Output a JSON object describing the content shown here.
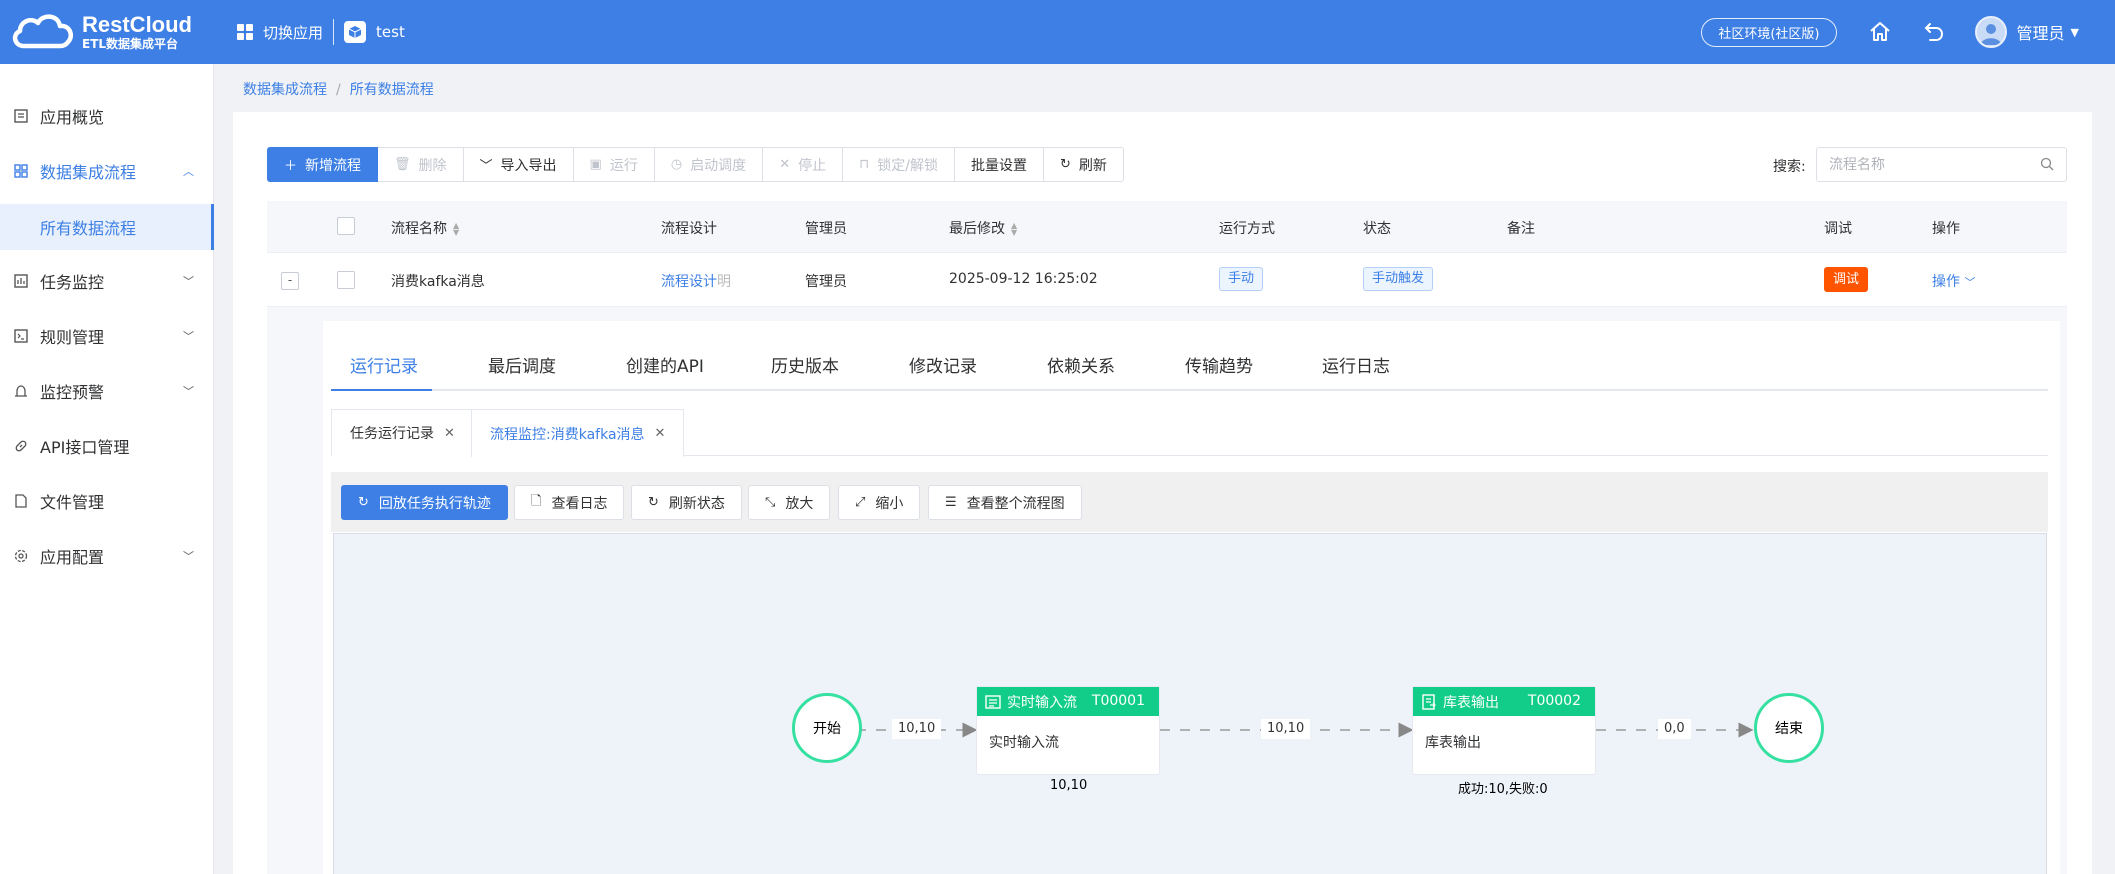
{
  "header": {
    "brand": "RestCloud",
    "brand_sub": "ETL数据集成平台",
    "switch_app": "切换应用",
    "app_name": "test",
    "env": "社区环境(社区版)",
    "user": "管理员"
  },
  "sidebar": {
    "items": [
      {
        "label": "应用概览",
        "icon": "overview-icon"
      },
      {
        "label": "数据集成流程",
        "icon": "grid-icon"
      },
      {
        "label": "所有数据流程"
      },
      {
        "label": "任务监控",
        "icon": "monitor-icon"
      },
      {
        "label": "规则管理",
        "icon": "terminal-icon"
      },
      {
        "label": "监控预警",
        "icon": "alarm-icon"
      },
      {
        "label": "API接口管理",
        "icon": "link-icon"
      },
      {
        "label": "文件管理",
        "icon": "file-icon"
      },
      {
        "label": "应用配置",
        "icon": "gear-icon"
      }
    ]
  },
  "breadcrumb": [
    "数据集成流程",
    "所有数据流程"
  ],
  "toolbar": {
    "new": "新增流程",
    "delete": "删除",
    "import_export": "导入导出",
    "run": "运行",
    "start_schedule": "启动调度",
    "stop": "停止",
    "lock": "锁定/解锁",
    "batch": "批量设置",
    "refresh": "刷新"
  },
  "search": {
    "label": "搜索:",
    "placeholder": "流程名称"
  },
  "table": {
    "columns": [
      "流程名称",
      "流程设计",
      "管理员",
      "最后修改",
      "运行方式",
      "状态",
      "备注",
      "调试",
      "操作"
    ],
    "row": {
      "expand": "-",
      "name": "消费kafka消息",
      "design": "流程设计",
      "design_suffix": "明",
      "admin": "管理员",
      "modified": "2025-09-12 16:25:02",
      "run_mode": "手动",
      "status": "手动触发",
      "note": "",
      "debug": "调试",
      "action": "操作"
    }
  },
  "tabs": [
    "运行记录",
    "最后调度",
    "创建的API",
    "历史版本",
    "修改记录",
    "依赖关系",
    "传输趋势",
    "运行日志"
  ],
  "subtabs": [
    "任务运行记录",
    "流程监控:消费kafka消息"
  ],
  "flow_toolbar": {
    "replay": "回放任务执行轨迹",
    "view_log": "查看日志",
    "refresh_status": "刷新状态",
    "zoom_in": "放大",
    "zoom_out": "缩小",
    "view_all": "查看整个流程图"
  },
  "flow": {
    "start": "开始",
    "end": "结束",
    "node1": {
      "title": "实时输入流",
      "id": "T00001",
      "body": "实时输入流",
      "stat": "10,10"
    },
    "node2": {
      "title": "库表输出",
      "id": "T00002",
      "body": "库表输出",
      "stat": "成功:10,失败:0"
    },
    "edge1": "10,10",
    "edge2": "10,10",
    "edge3": "0,0"
  },
  "colors": {
    "primary": "#3d7fe5",
    "node": "#12cd8a",
    "circle": "#35e0a1",
    "debug": "#ff5500"
  }
}
